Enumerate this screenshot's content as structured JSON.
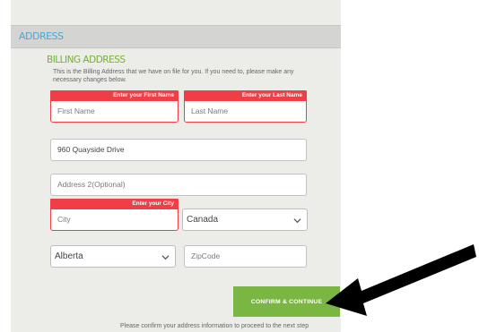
{
  "section": {
    "title": "ADDRESS"
  },
  "billing": {
    "title": "BILLING ADDRESS",
    "description": "This is the Billing Address that we have on file for you. If you need to, please make any necessary changes below."
  },
  "fields": {
    "first_name": {
      "error": "Enter your First Name",
      "placeholder": "First Name",
      "value": ""
    },
    "last_name": {
      "error": "Enter your Last Name",
      "placeholder": "Last Name",
      "value": ""
    },
    "address1": {
      "value": "960 Quayside Drive"
    },
    "address2": {
      "placeholder": "Address 2(Optional)",
      "value": ""
    },
    "city": {
      "error": "Enter your City",
      "placeholder": "City",
      "value": ""
    },
    "country": {
      "selected": "Canada"
    },
    "province": {
      "selected": "Alberta"
    },
    "zipcode": {
      "placeholder": "ZipCode",
      "value": ""
    }
  },
  "buttons": {
    "confirm": "CONFIRM & CONTINUE"
  },
  "note": "Please confirm your address information to proceed to the next step",
  "icons": {
    "chevron": "chevron-down-icon",
    "arrow": "pointer-arrow-icon"
  },
  "colors": {
    "accent_blue": "#41aadb",
    "accent_green": "#74b036",
    "error_red": "#ef3e45",
    "button_green": "#7ab642"
  }
}
